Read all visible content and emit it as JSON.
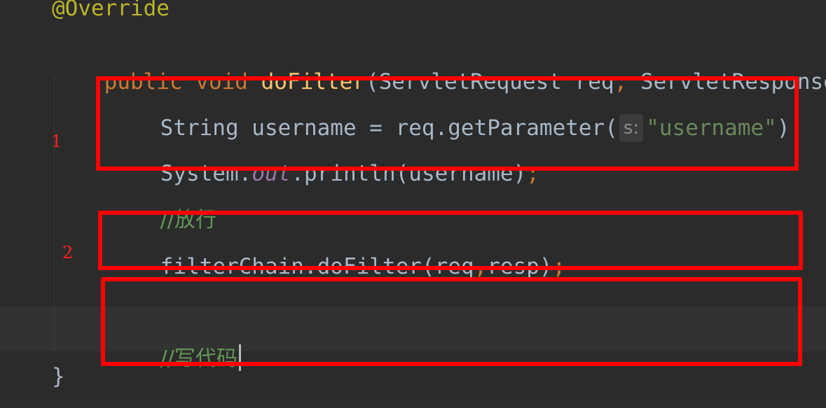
{
  "editor": {
    "line_annotation": "@Override",
    "signature": {
      "modifier": "public",
      "return_type": "void",
      "method_name": "doFilter",
      "open_paren": "(",
      "param1_type": "ServletRequest",
      "param1_name": " req",
      "comma": ",",
      "param2_type": " ServletResponse"
    },
    "line_username": {
      "code": "String username = req.getParameter(",
      "hint": "s:",
      "string_literal": "\"username\"",
      "close": ")",
      "semi": ";"
    },
    "line_println": {
      "prefix": "System.",
      "field": "out",
      "suffix": ".println(username)",
      "semi": ";"
    },
    "comment_release": "//放行",
    "line_filter": {
      "code1": "filterChain.doFilter(req",
      "comma": ",",
      "code2": "resp)",
      "semi": ";"
    },
    "comment_write": "//写代码",
    "closing_brace": "}"
  },
  "annotations": {
    "marker_1": "1",
    "marker_2": "2",
    "box_color": "#ff0000"
  },
  "colors": {
    "background": "#2b2b2b",
    "keyword": "#cc7832",
    "method": "#ffc66d",
    "string": "#6a8759",
    "comment": "#629755",
    "field": "#9876aa",
    "annotation": "#bbb529",
    "default_text": "#a9b7c6"
  }
}
